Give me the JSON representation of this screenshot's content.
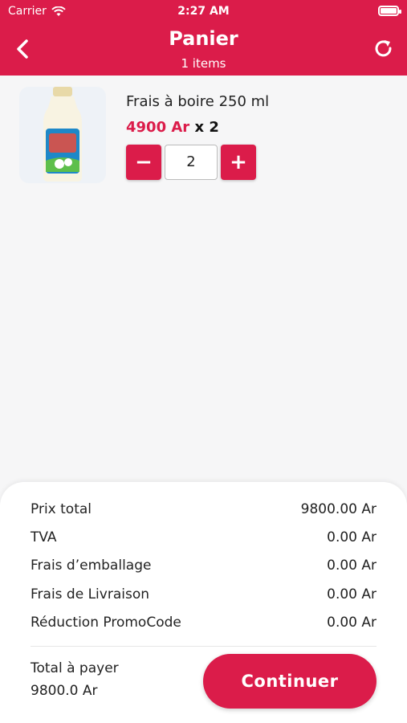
{
  "status_bar": {
    "carrier": "Carrier",
    "time": "2:27 AM"
  },
  "header": {
    "title": "Panier",
    "subtitle": "1 items",
    "back_icon": "chevron-left-icon",
    "refresh_icon": "refresh-icon"
  },
  "cart": {
    "items": [
      {
        "name": "Frais à boire 250 ml",
        "price": "4900 Ar",
        "multiplier": "x 2",
        "quantity": "2",
        "minus": "−",
        "plus": "+"
      }
    ]
  },
  "summary": {
    "rows": [
      {
        "label": "Prix total",
        "value": "9800.00 Ar"
      },
      {
        "label": "TVA",
        "value": "0.00 Ar"
      },
      {
        "label": "Frais d’emballage",
        "value": "0.00 Ar"
      },
      {
        "label": "Frais de Livraison",
        "value": "0.00 Ar"
      },
      {
        "label": "Réduction PromoCode",
        "value": "0.00 Ar"
      }
    ],
    "total_label": "Total à payer",
    "total_value": "9800.0 Ar",
    "continue_label": "Continuer"
  },
  "colors": {
    "accent": "#db1c4a",
    "background": "#f6f6f7"
  }
}
